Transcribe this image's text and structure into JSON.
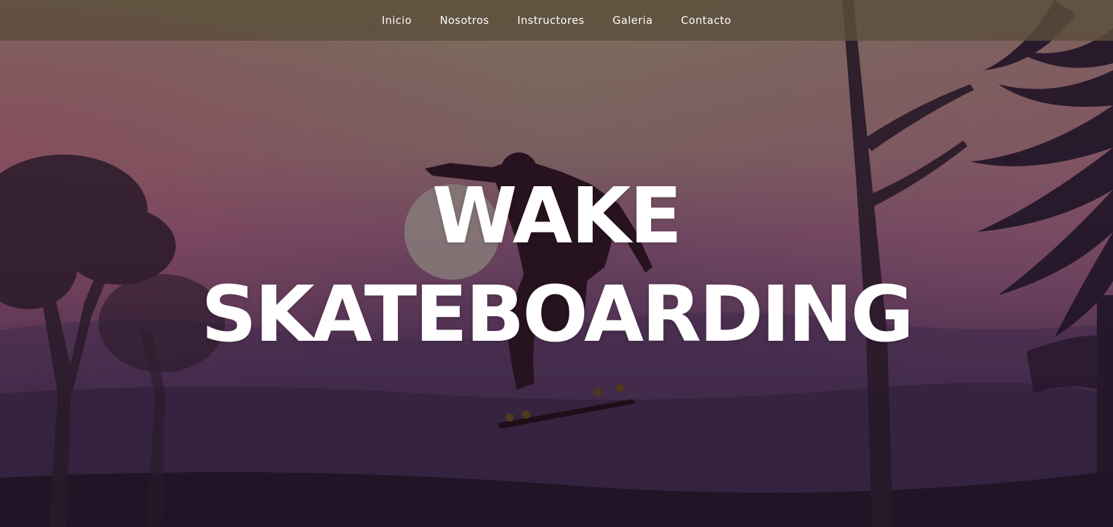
{
  "nav": {
    "items": [
      {
        "label": "Inicio"
      },
      {
        "label": "Nosotros"
      },
      {
        "label": "Instructores"
      },
      {
        "label": "Galeria"
      },
      {
        "label": "Contacto"
      }
    ]
  },
  "hero": {
    "title_line1": "WAKE",
    "title_line2": "SKATEBOARDING"
  },
  "colors": {
    "nav_bg": "#5c4e3a",
    "text": "#ffffff",
    "sky_top": "#8a7a66",
    "sky_mid": "#7a4d6a",
    "ground": "#2b1d34"
  }
}
